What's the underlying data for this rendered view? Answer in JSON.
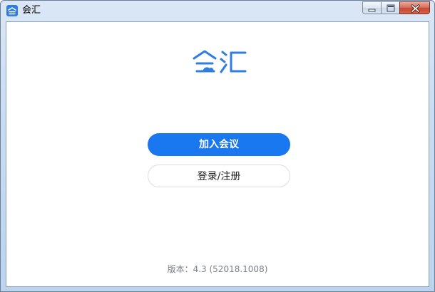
{
  "window": {
    "title": "会汇",
    "controls": [
      "minimize",
      "maximize",
      "close"
    ]
  },
  "app": {
    "logo_text": "会汇",
    "brand_color": "#2f7de1"
  },
  "main": {
    "join_button_label": "加入会议",
    "login_button_label": "登录/注册",
    "version_text": "版本：4.3 (52018.1008)"
  },
  "colors": {
    "primary": "#1977ef",
    "secondary_border": "#d9dde3",
    "version_text": "#7b7f86"
  }
}
